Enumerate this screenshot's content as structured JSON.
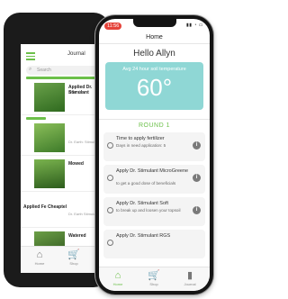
{
  "back_app": {
    "title": "Journal",
    "search_placeholder": "Search",
    "entries": [
      {
        "title": "Applied Dr. Stimulant",
        "subtitle": "Round 1",
        "meta": ""
      },
      {
        "title": "",
        "subtitle": "",
        "meta": "Dr. Earth: Stimulant"
      },
      {
        "title": "Mowed",
        "subtitle": "",
        "meta": ""
      },
      {
        "title": "Applied Fe Cheaptel",
        "subtitle": "",
        "meta": "Dr. Earth Stimulant"
      },
      {
        "title": "Watered",
        "subtitle": "",
        "meta": ""
      }
    ],
    "tabs": [
      {
        "label": "Home",
        "icon": "home-icon"
      },
      {
        "label": "Shop",
        "icon": "cart-icon"
      }
    ]
  },
  "front_app": {
    "status_time": "11:56",
    "nav_title": "Home",
    "greeting": "Hello Allyn",
    "temp_label": "Avg 24 hour soil temperature",
    "temp_value": "60°",
    "round_label": "ROUND 1",
    "tasks": [
      {
        "title": "Time to apply fertilizer",
        "desc": "Days in need application: 5"
      },
      {
        "title": "Apply Dr. Stimulant MicroGreene",
        "desc": "to get a good dose of beneficials"
      },
      {
        "title": "Apply Dr. Stimulant Soft",
        "desc": "to break up and loosen your topsoil"
      },
      {
        "title": "Apply Dr. Stimulant RGS",
        "desc": ""
      }
    ],
    "tabs": [
      {
        "label": "Home",
        "icon": "home-icon",
        "active": true
      },
      {
        "label": "Shop",
        "icon": "cart-icon",
        "active": false
      },
      {
        "label": "Journal",
        "icon": "journal-icon",
        "active": false
      }
    ],
    "colors": {
      "accent": "#6cc04a",
      "temp_card": "#8fd7d5",
      "status_pill": "#e5433a"
    }
  }
}
